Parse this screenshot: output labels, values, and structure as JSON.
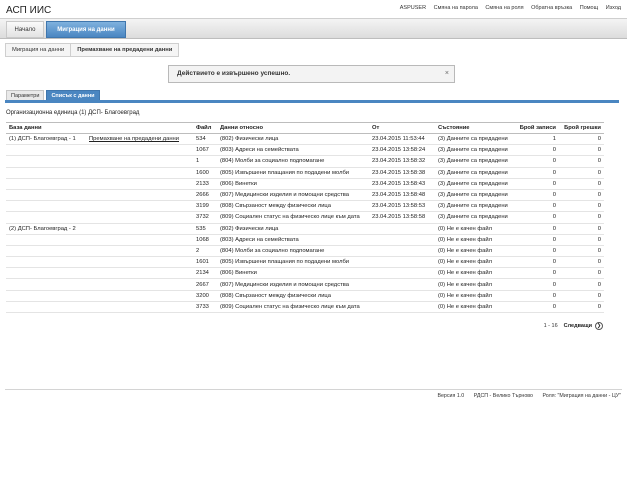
{
  "app_title": "АСП ИИС",
  "top_links": [
    "ASPUSER",
    "Смяна на парола",
    "Смяна на роля",
    "Обратна връзка",
    "Помощ",
    "Изход"
  ],
  "nav": [
    {
      "label": "Начало",
      "active": false
    },
    {
      "label": "Миграция на данни",
      "active": true
    }
  ],
  "breadcrumb": [
    "Миграция на данни",
    "Премахване на предадени данни"
  ],
  "alert": {
    "message": "Действието е извършено успешно.",
    "close": "×"
  },
  "tabs": [
    {
      "label": "Параметри",
      "active": false
    },
    {
      "label": "Списък с данни",
      "active": true
    }
  ],
  "org_unit": "Организационна единица (1) ДСП- Благоевград",
  "table": {
    "headers": [
      "База данни",
      "",
      "Файл",
      "Данни относно",
      "От",
      "Състояние",
      "Брой записи",
      "Брой грешки"
    ],
    "rows": [
      {
        "db": "(1) ДСП- Благоевград - 1",
        "action": "Премахване на предадени данни",
        "file": "534",
        "about": "(802) Физически лица",
        "from": "23.04.2015 11:53:44",
        "status": "(3) Данните са предадени",
        "records": "1",
        "errors": "0"
      },
      {
        "db": "",
        "action": "",
        "file": "1067",
        "about": "(803) Адреси на семействата",
        "from": "23.04.2015 13:58:24",
        "status": "(3) Данните са предадени",
        "records": "0",
        "errors": "0"
      },
      {
        "db": "",
        "action": "",
        "file": "1",
        "about": "(804) Молби за социално подпомагане",
        "from": "23.04.2015 13:58:32",
        "status": "(3) Данните са предадени",
        "records": "0",
        "errors": "0"
      },
      {
        "db": "",
        "action": "",
        "file": "1600",
        "about": "(805) Извършени плащания по подадени молби",
        "from": "23.04.2015 13:58:38",
        "status": "(3) Данните са предадени",
        "records": "0",
        "errors": "0"
      },
      {
        "db": "",
        "action": "",
        "file": "2133",
        "about": "(806) Винетки",
        "from": "23.04.2015 13:58:43",
        "status": "(3) Данните са предадени",
        "records": "0",
        "errors": "0"
      },
      {
        "db": "",
        "action": "",
        "file": "2666",
        "about": "(807) Медицински изделия и помощни средства",
        "from": "23.04.2015 13:58:48",
        "status": "(3) Данните са предадени",
        "records": "0",
        "errors": "0"
      },
      {
        "db": "",
        "action": "",
        "file": "3199",
        "about": "(808) Свързаност между физически лица",
        "from": "23.04.2015 13:58:53",
        "status": "(3) Данните са предадени",
        "records": "0",
        "errors": "0"
      },
      {
        "db": "",
        "action": "",
        "file": "3732",
        "about": "(809) Социален статус на физическо лице към дата",
        "from": "23.04.2015 13:58:58",
        "status": "(3) Данните са предадени",
        "records": "0",
        "errors": "0"
      },
      {
        "db": "(2) ДСП- Благоевград - 2",
        "action": "",
        "file": "535",
        "about": "(802) Физически лица",
        "from": "",
        "status": "(0) Не е качен файл",
        "records": "0",
        "errors": "0"
      },
      {
        "db": "",
        "action": "",
        "file": "1068",
        "about": "(803) Адреси на семействата",
        "from": "",
        "status": "(0) Не е качен файл",
        "records": "0",
        "errors": "0"
      },
      {
        "db": "",
        "action": "",
        "file": "2",
        "about": "(804) Молби за социално подпомагане",
        "from": "",
        "status": "(0) Не е качен файл",
        "records": "0",
        "errors": "0"
      },
      {
        "db": "",
        "action": "",
        "file": "1601",
        "about": "(805) Извършени плащания по подадени молби",
        "from": "",
        "status": "(0) Не е качен файл",
        "records": "0",
        "errors": "0"
      },
      {
        "db": "",
        "action": "",
        "file": "2134",
        "about": "(806) Винетки",
        "from": "",
        "status": "(0) Не е качен файл",
        "records": "0",
        "errors": "0"
      },
      {
        "db": "",
        "action": "",
        "file": "2667",
        "about": "(807) Медицински изделия и помощни средства",
        "from": "",
        "status": "(0) Не е качен файл",
        "records": "0",
        "errors": "0"
      },
      {
        "db": "",
        "action": "",
        "file": "3200",
        "about": "(808) Свързаност между физически лица",
        "from": "",
        "status": "(0) Не е качен файл",
        "records": "0",
        "errors": "0"
      },
      {
        "db": "",
        "action": "",
        "file": "3733",
        "about": "(809) Социален статус на физическо лице към дата",
        "from": "",
        "status": "(0) Не е качен файл",
        "records": "0",
        "errors": "0"
      }
    ]
  },
  "pager": {
    "range": "1 - 16",
    "next": "Следващи",
    "icon": "chevron-right-icon"
  },
  "footer": {
    "version": "Версия 1.0",
    "unit": "РДСП - Велико Търново",
    "role": "Роля: \"Миграция на данни - ЦУ\""
  },
  "colors": {
    "accent": "#4a86c1",
    "nav_bg": "#dcdcdc"
  }
}
